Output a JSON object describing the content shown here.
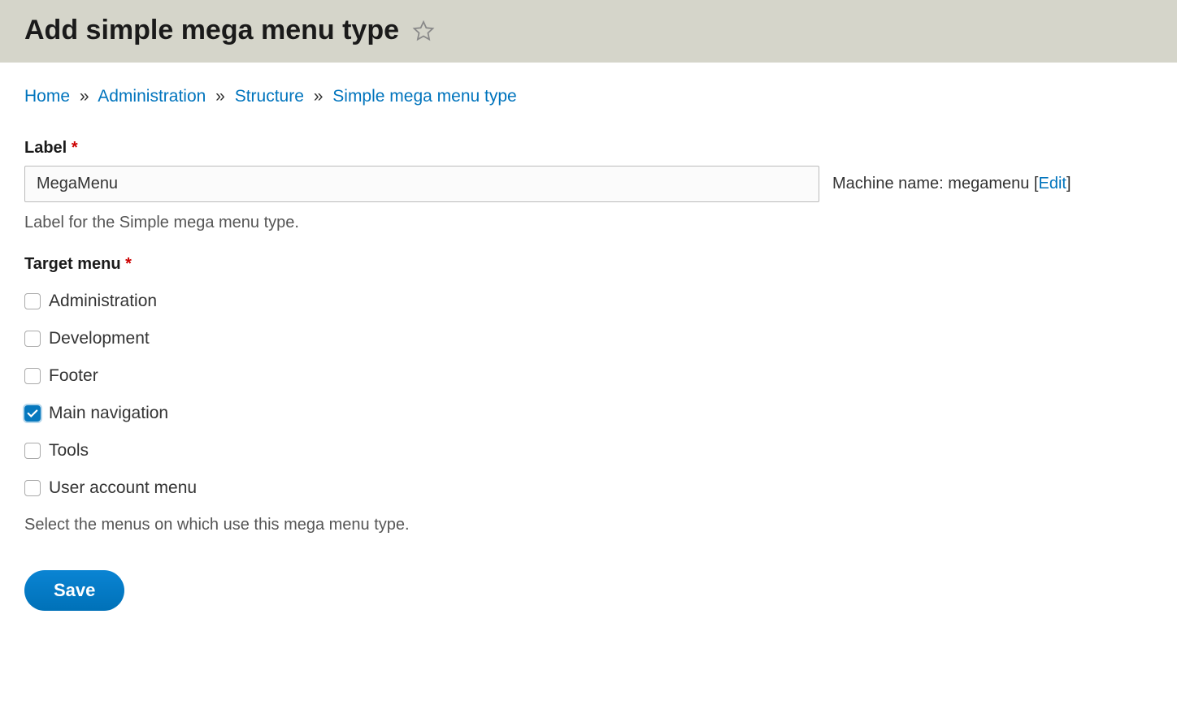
{
  "header": {
    "title": "Add simple mega menu type"
  },
  "breadcrumb": {
    "items": [
      {
        "label": "Home"
      },
      {
        "label": "Administration"
      },
      {
        "label": "Structure"
      },
      {
        "label": "Simple mega menu type"
      }
    ],
    "separator": "»"
  },
  "form": {
    "label_field": {
      "label": "Label",
      "value": "MegaMenu",
      "description": "Label for the Simple mega menu type."
    },
    "machine_name": {
      "prefix": "Machine name: ",
      "value": "megamenu",
      "edit_label": "Edit",
      "bracket_open": " [",
      "bracket_close": "]"
    },
    "target_menu": {
      "label": "Target menu",
      "options": [
        {
          "label": "Administration",
          "checked": false
        },
        {
          "label": "Development",
          "checked": false
        },
        {
          "label": "Footer",
          "checked": false
        },
        {
          "label": "Main navigation",
          "checked": true
        },
        {
          "label": "Tools",
          "checked": false
        },
        {
          "label": "User account menu",
          "checked": false
        }
      ],
      "description": "Select the menus on which use this mega menu type."
    },
    "save_label": "Save"
  }
}
